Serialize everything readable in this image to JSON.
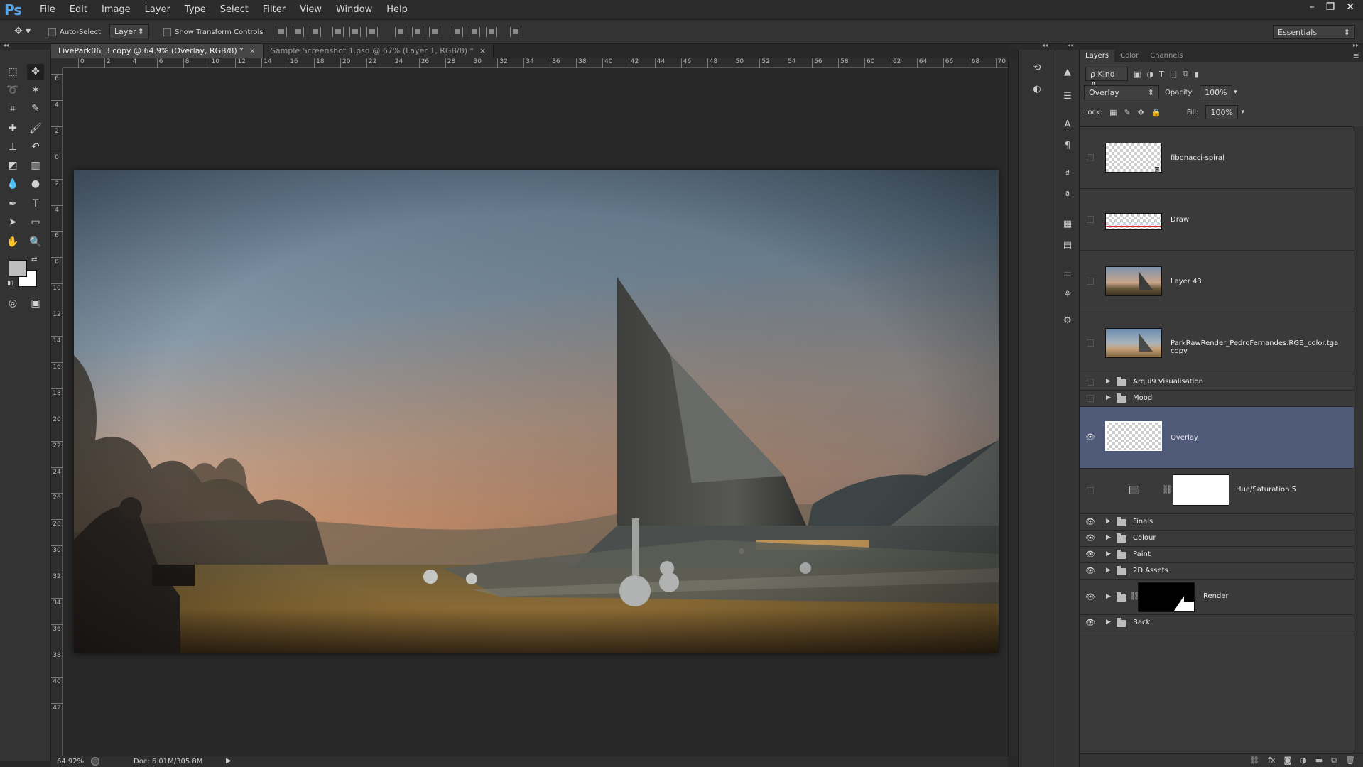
{
  "app": {
    "logo": "Ps",
    "menu": [
      "File",
      "Edit",
      "Image",
      "Layer",
      "Type",
      "Select",
      "Filter",
      "View",
      "Window",
      "Help"
    ],
    "window_controls": [
      "–",
      "❐",
      "✕"
    ]
  },
  "options_bar": {
    "auto_select_label": "Auto-Select",
    "auto_select_target": "Layer",
    "show_transform_label": "Show Transform Controls",
    "workspace": "Essentials"
  },
  "tabs": [
    {
      "label": "LivePark06_3 copy @ 64.9% (Overlay, RGB/8) *",
      "close": "×",
      "active": true
    },
    {
      "label": "Sample Screenshot 1.psd @ 67% (Layer 1, RGB/8) *",
      "close": "×",
      "active": false
    }
  ],
  "ruler": {
    "h_labels": [
      "0",
      "2",
      "4",
      "6",
      "8",
      "10",
      "12",
      "14",
      "16",
      "18",
      "20",
      "22",
      "24",
      "26",
      "28",
      "30",
      "32",
      "34",
      "36",
      "38",
      "40",
      "42",
      "44",
      "46",
      "48",
      "50",
      "52",
      "54",
      "56",
      "58",
      "60",
      "62",
      "64",
      "66",
      "68",
      "70"
    ],
    "v_labels": [
      "6",
      "4",
      "2",
      "0",
      "2",
      "4",
      "6",
      "8",
      "10",
      "12",
      "14",
      "16",
      "18",
      "20",
      "22",
      "24",
      "26",
      "28",
      "30",
      "32",
      "34",
      "36",
      "38",
      "40",
      "42"
    ]
  },
  "status": {
    "zoom": "64.92%",
    "doc": "Doc: 6.01M/305.8M"
  },
  "layers_panel": {
    "tabs": [
      "Layers",
      "Color",
      "Channels"
    ],
    "filter_kind": "ρ Kind",
    "blend_mode": "Overlay",
    "opacity_label": "Opacity:",
    "opacity": "100%",
    "lock_label": "Lock:",
    "fill_label": "Fill:",
    "fill": "100%",
    "layers": [
      {
        "name": "fibonacci-spiral",
        "kind": "layer",
        "visible": false,
        "thumb": "checker-smart"
      },
      {
        "name": "Draw",
        "kind": "layer",
        "visible": false,
        "thumb": "draw"
      },
      {
        "name": "Layer 43",
        "kind": "layer",
        "visible": false,
        "thumb": "photo"
      },
      {
        "name": "ParkRawRender_PedroFernandes.RGB_color.tga copy",
        "kind": "layer",
        "visible": false,
        "thumb": "photo2"
      },
      {
        "name": "Arqui9 Visualisation",
        "kind": "group",
        "visible": false
      },
      {
        "name": "Mood",
        "kind": "group",
        "visible": false
      },
      {
        "name": "Overlay",
        "kind": "layer",
        "visible": true,
        "selected": true,
        "thumb": "checker"
      },
      {
        "name": "Hue/Saturation 5",
        "kind": "adjustment",
        "visible": false
      },
      {
        "name": "Finals",
        "kind": "group",
        "visible": true
      },
      {
        "name": "Colour",
        "kind": "group",
        "visible": true
      },
      {
        "name": "Paint",
        "kind": "group",
        "visible": true
      },
      {
        "name": "2D Assets",
        "kind": "group",
        "visible": true
      },
      {
        "name": "Render",
        "kind": "group-mask",
        "visible": true
      },
      {
        "name": "Back",
        "kind": "group",
        "visible": true
      }
    ]
  },
  "icons": {
    "eye": "eye-icon",
    "folder": "folder-icon",
    "chain": "link-icon"
  }
}
